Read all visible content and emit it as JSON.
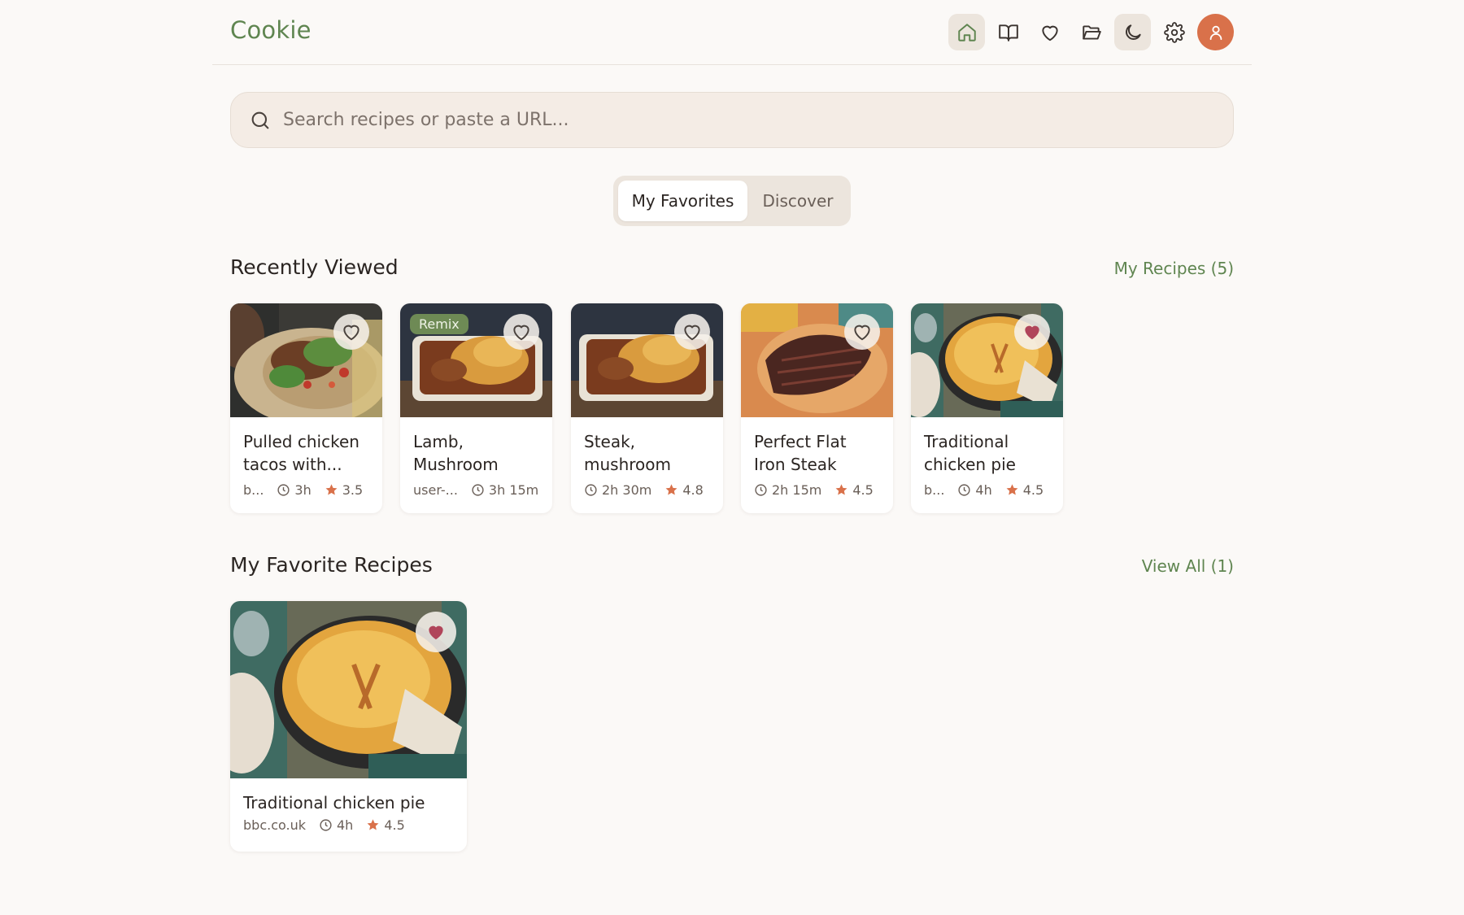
{
  "app": {
    "title": "Cookie"
  },
  "nav": {
    "items": [
      "home-icon",
      "book-icon",
      "heart-icon",
      "folder-icon",
      "moon-icon",
      "gear-icon",
      "user-icon"
    ]
  },
  "search": {
    "placeholder": "Search recipes or paste a URL..."
  },
  "tabs": [
    {
      "label": "My Favorites",
      "active": true
    },
    {
      "label": "Discover",
      "active": false
    }
  ],
  "recently_viewed": {
    "title": "Recently Viewed",
    "link": "My Recipes (5)",
    "cards": [
      {
        "title": "Pulled chicken tacos with...",
        "source": "b...",
        "time": "3h",
        "rating": "3.5",
        "favorite": false,
        "badge": ""
      },
      {
        "title": "Lamb, Mushroom an...",
        "source": "user-...",
        "time": "3h 15m",
        "rating": "",
        "favorite": false,
        "badge": "Remix"
      },
      {
        "title": "Steak, mushroom an...",
        "source": "",
        "time": "2h 30m",
        "rating": "4.8",
        "favorite": false,
        "badge": ""
      },
      {
        "title": "Perfect Flat Iron Steak",
        "source": "",
        "time": "2h 15m",
        "rating": "4.5",
        "favorite": false,
        "badge": ""
      },
      {
        "title": "Traditional chicken pie",
        "source": "b...",
        "time": "4h",
        "rating": "4.5",
        "favorite": true,
        "badge": ""
      }
    ]
  },
  "favorites": {
    "title": "My Favorite Recipes",
    "link": "View All (1)",
    "cards": [
      {
        "title": "Traditional chicken pie",
        "source": "bbc.co.uk",
        "time": "4h",
        "rating": "4.5",
        "favorite": true
      }
    ]
  },
  "colors": {
    "brand": "#5f8550",
    "accent": "#d9714a",
    "favorite": "#b0455a",
    "background": "#fbf9f7"
  }
}
